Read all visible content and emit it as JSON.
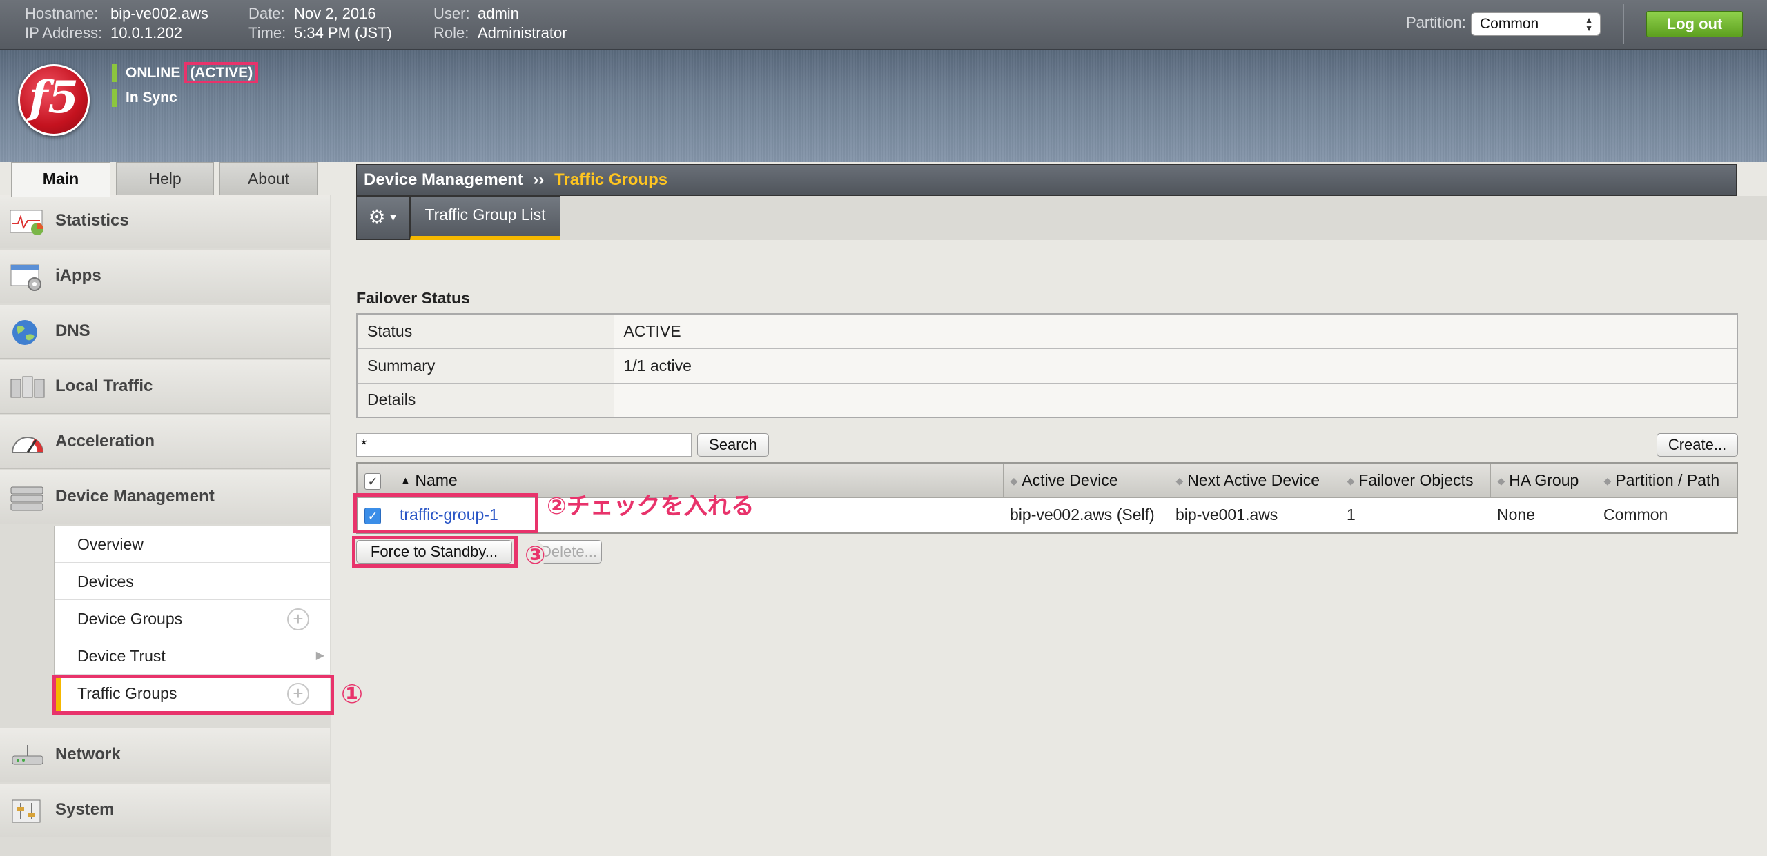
{
  "topbar": {
    "hostname_label": "Hostname:",
    "hostname": "bip-ve002.aws",
    "ip_label": "IP Address:",
    "ip": "10.0.1.202",
    "date_label": "Date:",
    "date": "Nov 2, 2016",
    "time_label": "Time:",
    "time": "5:34 PM (JST)",
    "user_label": "User:",
    "user": "admin",
    "role_label": "Role:",
    "role": "Administrator",
    "partition_label": "Partition:",
    "partition_value": "Common",
    "logout_label": "Log out"
  },
  "banner": {
    "status_online": "ONLINE",
    "status_active": "(ACTIVE)",
    "status_sync": "In Sync",
    "logo_text": "f5"
  },
  "nav_tabs": [
    "Main",
    "Help",
    "About"
  ],
  "nav": {
    "items": [
      "Statistics",
      "iApps",
      "DNS",
      "Local Traffic",
      "Acceleration",
      "Device Management",
      "Network",
      "System"
    ],
    "subitems": [
      "Overview",
      "Devices",
      "Device Groups",
      "Device Trust",
      "Traffic Groups"
    ]
  },
  "breadcrumb": {
    "parent": "Device Management",
    "separator": "››",
    "current": "Traffic Groups"
  },
  "subtab": {
    "label": "Traffic Group List"
  },
  "failover": {
    "title": "Failover Status",
    "rows": [
      {
        "key": "Status",
        "value": "ACTIVE"
      },
      {
        "key": "Summary",
        "value": "1/1 active"
      },
      {
        "key": "Details",
        "value": ""
      }
    ]
  },
  "list": {
    "filter_value": "*",
    "search_label": "Search",
    "create_label": "Create...",
    "columns": [
      "Name",
      "Active Device",
      "Next Active Device",
      "Failover Objects",
      "HA Group",
      "Partition / Path"
    ],
    "rows": [
      {
        "name": "traffic-group-1",
        "active_device": "bip-ve002.aws (Self)",
        "next_active": "bip-ve001.aws",
        "failover_objects": "1",
        "ha_group": "None",
        "partition": "Common"
      }
    ],
    "force_standby_label": "Force to Standby...",
    "delete_label": "Delete..."
  },
  "annotations": {
    "step1": "①",
    "step2": "②チェックを入れる",
    "step3": "③"
  },
  "colors": {
    "accent": "#e8336b",
    "active_tab": "#f5b800",
    "logout": "#6db52c"
  }
}
